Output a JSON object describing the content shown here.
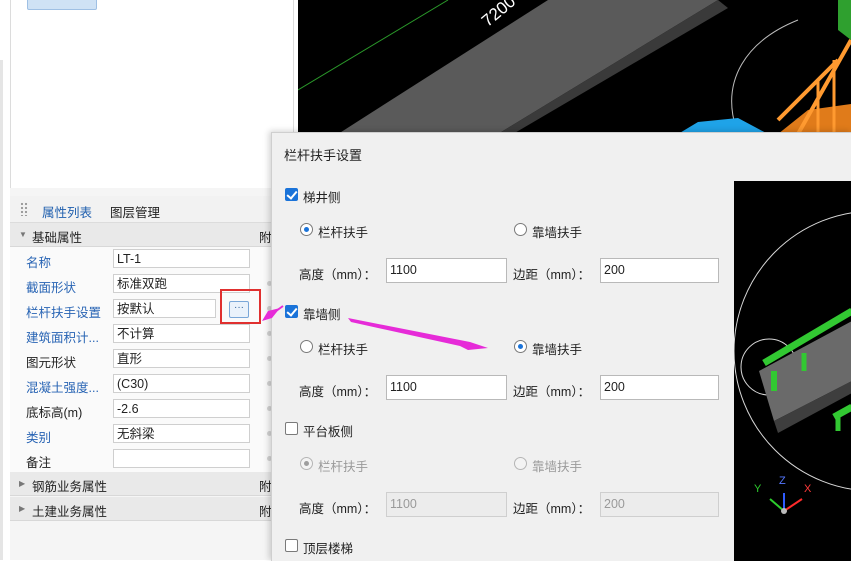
{
  "viewport": {
    "dimension_label": "7200"
  },
  "properties_panel": {
    "tabs": [
      "属性列表",
      "图层管理"
    ],
    "groups": {
      "basic": "基础属性",
      "rebar": "钢筋业务属性",
      "civil": "土建业务属性",
      "extra_label": "附"
    },
    "rows": [
      {
        "name": "名称",
        "value": "LT-1"
      },
      {
        "name": "截面形状",
        "value": "标准双跑"
      },
      {
        "name": "栏杆扶手设置",
        "value": "按默认"
      },
      {
        "name": "建筑面积计...",
        "value": "不计算"
      },
      {
        "name": "图元形状",
        "value": "直形"
      },
      {
        "name": "混凝土强度...",
        "value": "(C30)"
      },
      {
        "name": "底标高(m)",
        "value": "-2.6"
      },
      {
        "name": "类别",
        "value": "无斜梁"
      },
      {
        "name": "备注",
        "value": ""
      }
    ],
    "ellipsis_icon": "···"
  },
  "dialog": {
    "title": "栏杆扶手设置",
    "sections": [
      {
        "label": "梯井侧",
        "checked": true,
        "options": [
          "栏杆扶手",
          "靠墙扶手"
        ],
        "selected": 0,
        "height_label": "高度（mm）：",
        "height": "1100",
        "margin_label": "边距（mm）：",
        "margin": "200",
        "disabled": false
      },
      {
        "label": "靠墙侧",
        "checked": true,
        "options": [
          "栏杆扶手",
          "靠墙扶手"
        ],
        "selected": 1,
        "height_label": "高度（mm）：",
        "height": "1100",
        "margin_label": "边距（mm）：",
        "margin": "200",
        "disabled": false
      },
      {
        "label": "平台板侧",
        "checked": false,
        "options": [
          "栏杆扶手",
          "靠墙扶手"
        ],
        "selected": 0,
        "height_label": "高度（mm）：",
        "height": "1100",
        "margin_label": "边距（mm）：",
        "margin": "200",
        "disabled": true
      }
    ],
    "top_floor_label": "顶层楼梯",
    "top_floor_checked": false
  },
  "axis_gizmo": {
    "x": "X",
    "y": "Y",
    "z": "Z"
  },
  "colors": {
    "accent": "#1a73d9",
    "highlight": "#e0302f",
    "arrow": "#e62bd8"
  }
}
